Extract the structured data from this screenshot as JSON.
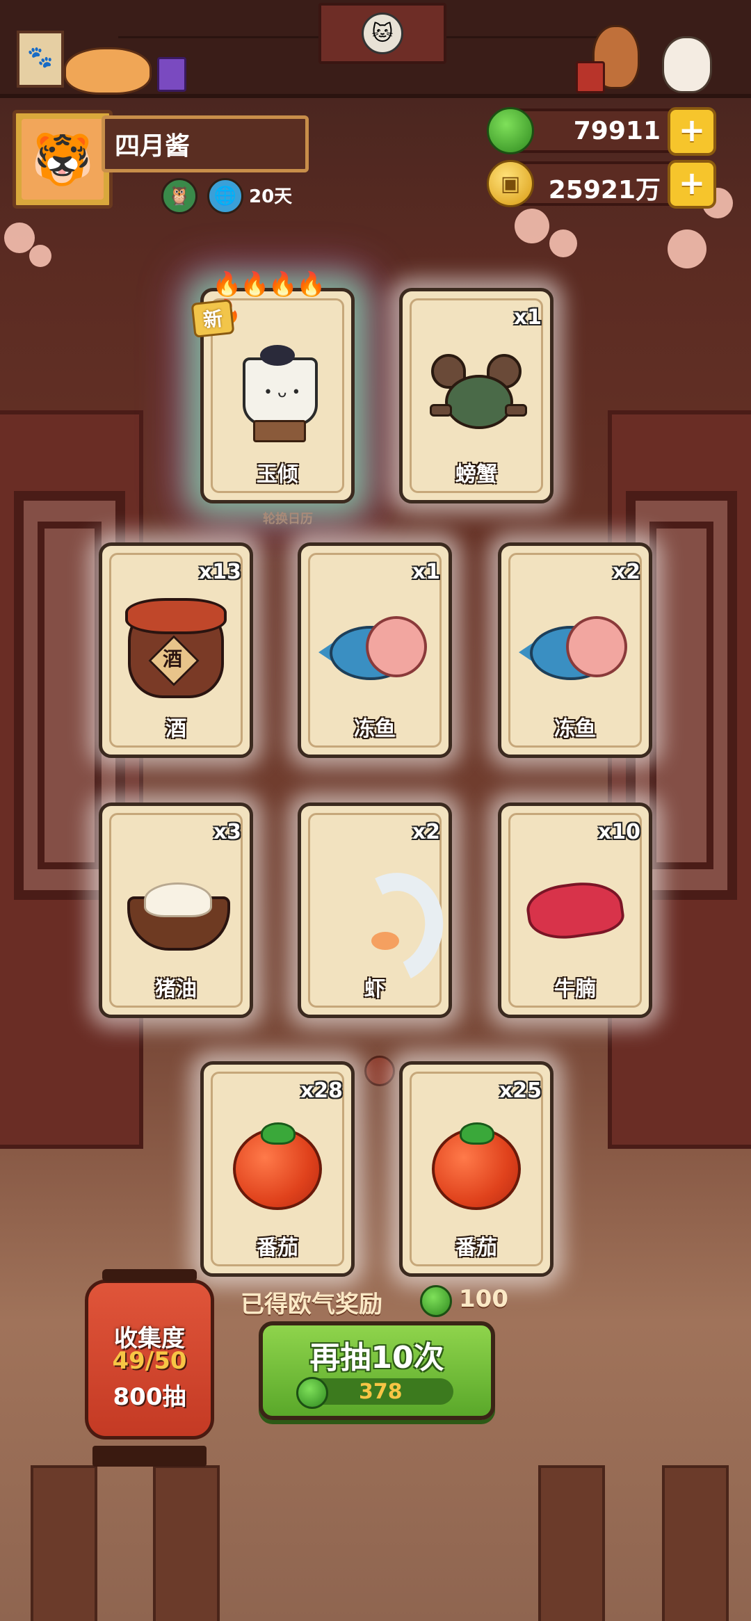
{
  "player": {
    "name": "四月酱",
    "days": "20天"
  },
  "currency": {
    "jade": "79911",
    "coins": "25921万"
  },
  "calendar_caption": "轮换日历",
  "badges": {
    "new": "新"
  },
  "cards": [
    {
      "label": "玉倾",
      "count": "",
      "rarity": "legendary",
      "art": "teacup-spirit"
    },
    {
      "label": "螃蟹",
      "count": "x1",
      "art": "crab"
    },
    {
      "label": "酒",
      "count": "x13",
      "art": "wine-jar"
    },
    {
      "label": "冻鱼",
      "count": "x1",
      "art": "frozen-fish"
    },
    {
      "label": "冻鱼",
      "count": "x2",
      "art": "frozen-fish"
    },
    {
      "label": "猪油",
      "count": "x3",
      "art": "lard-bowl"
    },
    {
      "label": "虾",
      "count": "x2",
      "art": "shrimp"
    },
    {
      "label": "牛腩",
      "count": "x10",
      "art": "beef-brisket"
    },
    {
      "label": "番茄",
      "count": "x28",
      "art": "tomato"
    },
    {
      "label": "番茄",
      "count": "x25",
      "art": "tomato"
    }
  ],
  "jar_glyph": "酒",
  "reward": {
    "label": "已得欧气奖励",
    "value": "100"
  },
  "draw_button": {
    "label": "再抽10次",
    "cost": "378"
  },
  "collection": {
    "label": "收集度",
    "progress": "49/50",
    "draws": "800抽"
  },
  "colors": {
    "accent_green": "#5aa82a",
    "gold": "#f6c52c",
    "jade": "#2f8a1f"
  }
}
